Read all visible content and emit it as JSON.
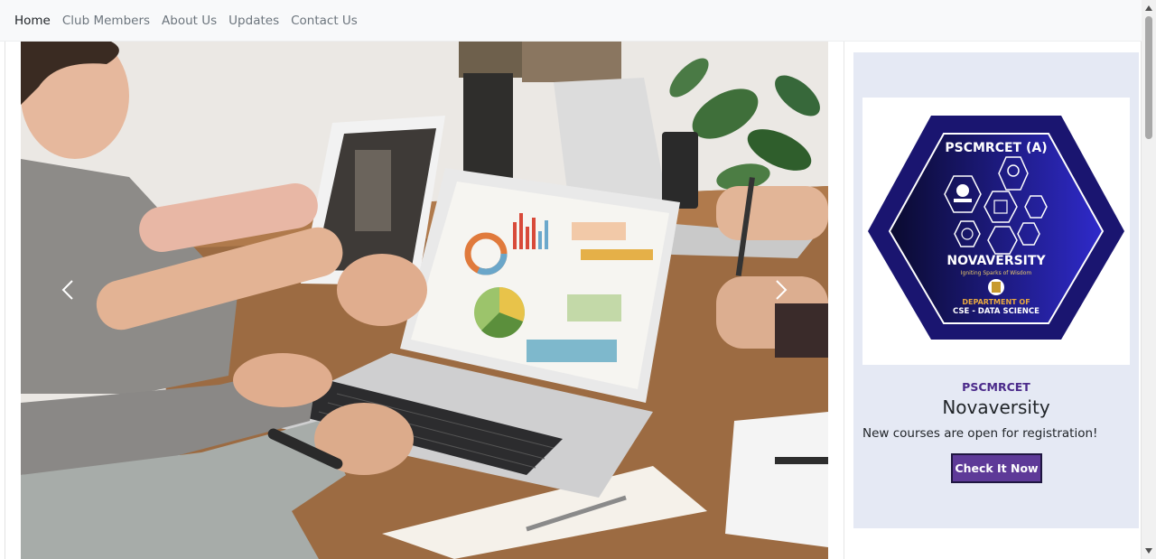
{
  "nav": {
    "items": [
      {
        "label": "Home",
        "active": true
      },
      {
        "label": "Club Members",
        "active": false
      },
      {
        "label": "About Us",
        "active": false
      },
      {
        "label": "Updates",
        "active": false
      },
      {
        "label": "Contact Us",
        "active": false
      }
    ]
  },
  "carousel": {
    "prev_icon": "chevron-left-icon",
    "next_icon": "chevron-right-icon"
  },
  "logo": {
    "top_text": "PSCMRCET (A)",
    "name": "NOVAVERSITY",
    "tagline": "Igniting Sparks of Wisdom",
    "dept_line1": "DEPARTMENT OF",
    "dept_line2": "CSE - DATA SCIENCE"
  },
  "card": {
    "subtitle": "PSCMRCET",
    "title": "Novaversity",
    "text": "New courses are open for registration!",
    "button_label": "Check It Now"
  },
  "colors": {
    "nav_bg": "#f8f9fa",
    "card_bg": "#e5e9f4",
    "accent": "#5e3a98",
    "logo_navy": "#1a1570"
  }
}
